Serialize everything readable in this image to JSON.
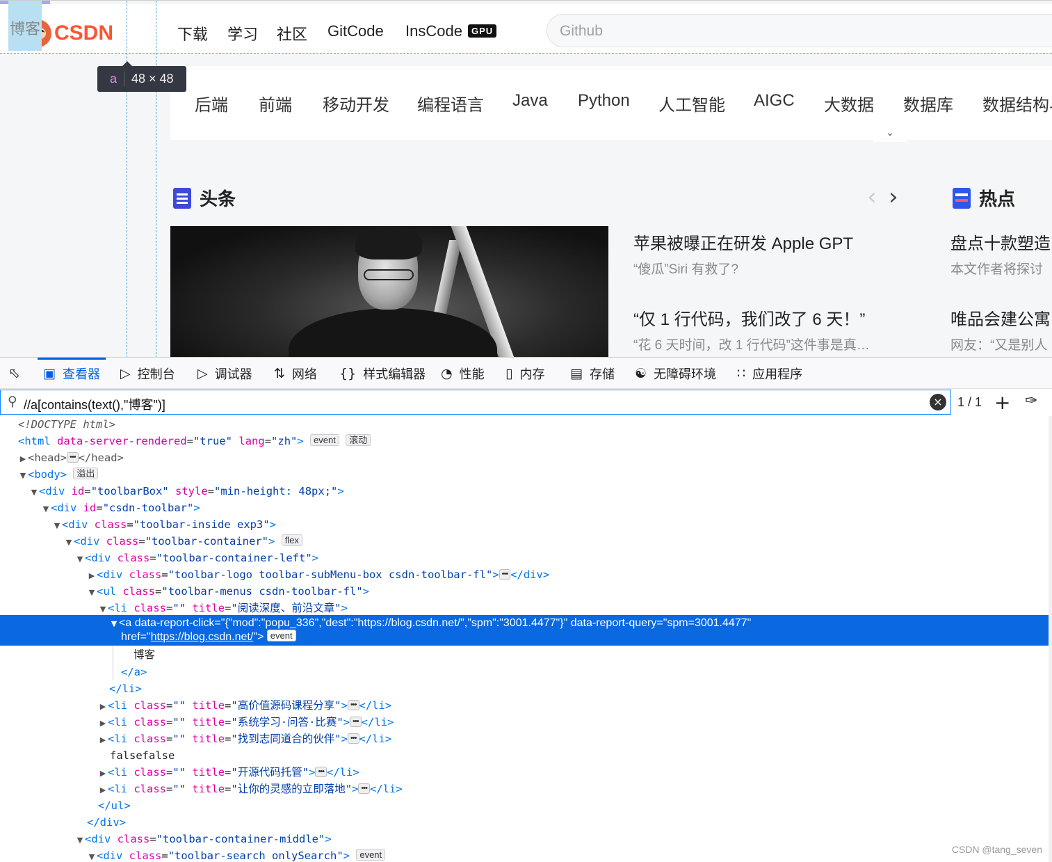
{
  "toolbar": {
    "logo_text": "CSDN",
    "nav": [
      "博客",
      "下载",
      "学习",
      "社区",
      "GitCode",
      "InsCode"
    ],
    "gpu_badge": "GPU",
    "search_placeholder": "Github"
  },
  "tooltip": {
    "tag": "a",
    "size": "48 × 48"
  },
  "categories": [
    "后端",
    "前端",
    "移动开发",
    "编程语言",
    "Java",
    "Python",
    "人工智能",
    "AIGC",
    "大数据",
    "数据库",
    "数据结构与"
  ],
  "headline": {
    "title": "头条",
    "news": [
      {
        "title": "苹果被曝正在研发 Apple GPT",
        "sub": "“傻瓜”Siri 有救了?"
      },
      {
        "title": "“仅 1 行代码，我们改了 6 天！”",
        "sub": "“花 6 天时间，改 1 行代码”这件事是真…"
      }
    ]
  },
  "hot": {
    "title": "热点",
    "news": [
      {
        "title": "盘点十款塑造",
        "sub": "本文作者将探讨"
      },
      {
        "title": "唯品会建公寓",
        "sub": "网友：“又是别人"
      }
    ]
  },
  "devtools": {
    "tabs": [
      "查看器",
      "控制台",
      "调试器",
      "网络",
      "样式编辑器",
      "性能",
      "内存",
      "存储",
      "无障碍环境",
      "应用程序"
    ],
    "search_query": "//a[contains(text(),\"博客\")]",
    "match_count": "1 / 1"
  },
  "markup": {
    "doctype": "<!DOCTYPE html>",
    "html_server_rendered": "true",
    "html_lang": "zh",
    "badge_event": "event",
    "badge_scroll": "滚动",
    "badge_overflow": "溢出",
    "badge_flex": "flex",
    "toolbarbox_style": "min-height: 48px;",
    "li_title_1": "阅读深度、前沿文章",
    "a_report_click": "{\"mod\":\"popu_336\",\"dest\":\"https://blog.csdn.net/\",\"spm\":\"3001.4477\"}",
    "a_report_query": "spm=3001.4477",
    "a_href": "https://blog.csdn.net/",
    "a_text": "博客",
    "li_title_2": "高价值源码课程分享",
    "li_title_3": "系统学习·问答·比赛",
    "li_title_4": "找到志同道合的伙伴",
    "text_node": "falsefalse",
    "li_title_5": "开源代码托管",
    "li_title_6": "让你的灵感的立即落地"
  },
  "watermark": "CSDN @tang_seven",
  "colors": {
    "brand": "#fc5531",
    "devtools_accent": "#0060df",
    "selection": "#0a68e0"
  }
}
